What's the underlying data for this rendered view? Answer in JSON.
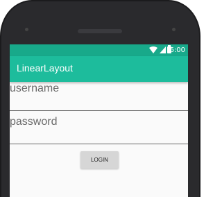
{
  "status_bar": {
    "time": "6:00"
  },
  "toolbar": {
    "title": "LinearLayout"
  },
  "form": {
    "username_hint": "username",
    "password_hint": "password",
    "login_label": "LOGIN"
  },
  "colors": {
    "status_bar": "#18a98a",
    "toolbar": "#1dbc9c"
  }
}
